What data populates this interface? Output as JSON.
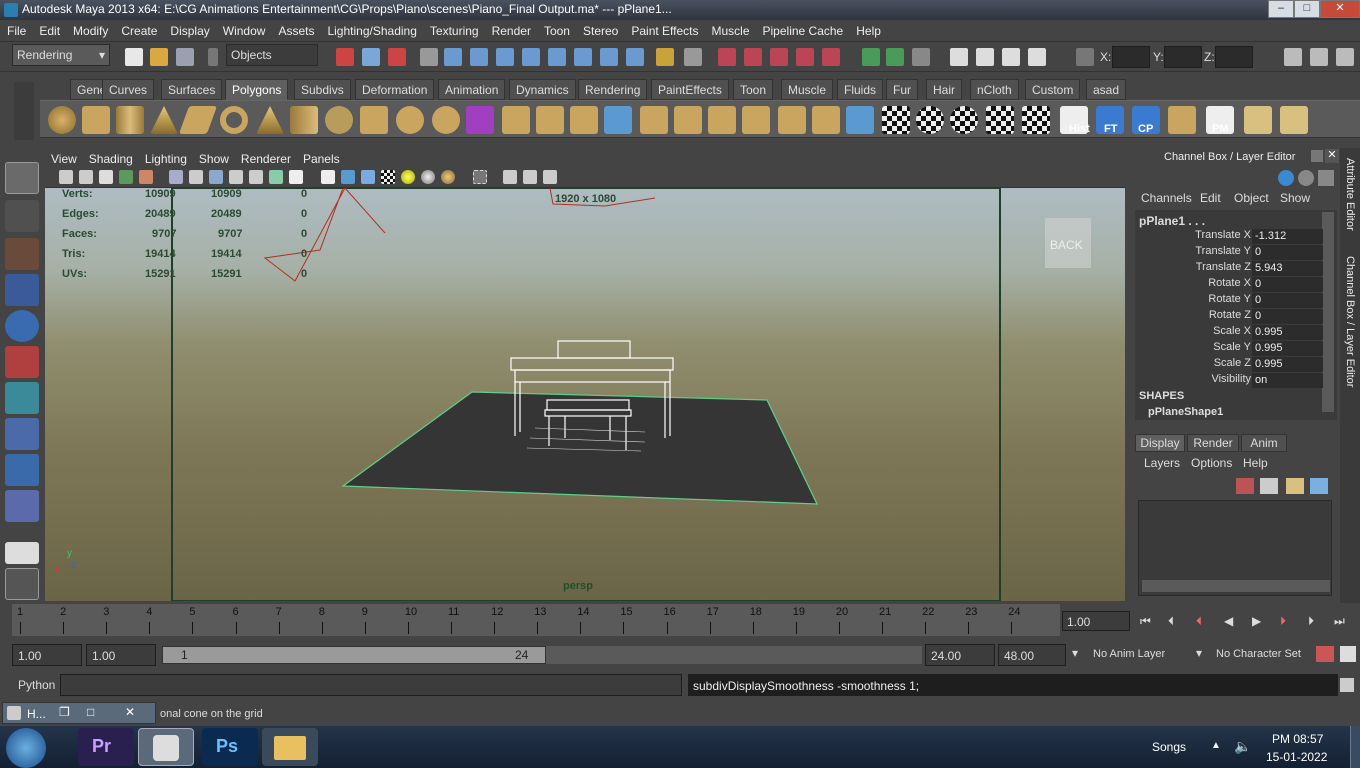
{
  "window": {
    "title": "Autodesk Maya 2013 x64: E:\\CG Animations Entertainment\\CG\\Props\\Piano\\scenes\\Piano_Final Output.ma*   ---   pPlane1...",
    "minimize": "–",
    "maximize": "□",
    "close": "✕"
  },
  "menubar": [
    "File",
    "Edit",
    "Modify",
    "Create",
    "Display",
    "Window",
    "Assets",
    "Lighting/Shading",
    "Texturing",
    "Render",
    "Toon",
    "Stereo",
    "Paint Effects",
    "Muscle",
    "Pipeline Cache",
    "Help"
  ],
  "statusline": {
    "menuset": "Rendering",
    "selection_mode": "Objects",
    "x_label": "X:",
    "y_label": "Y:",
    "z_label": "Z:"
  },
  "shelf": {
    "tabs": [
      "General",
      "Curves",
      "Surfaces",
      "Polygons",
      "Subdivs",
      "Deformation",
      "Animation",
      "Dynamics",
      "Rendering",
      "PaintEffects",
      "Toon",
      "Muscle",
      "Fluids",
      "Fur",
      "Hair",
      "nCloth",
      "Custom",
      "asad"
    ],
    "active_tab": "Polygons",
    "labels": {
      "hist": "Hist",
      "ft": "FT",
      "cp": "CP",
      "pm": "PM"
    }
  },
  "panel": {
    "menus": [
      "View",
      "Shading",
      "Lighting",
      "Show",
      "Renderer",
      "Panels"
    ],
    "resolution_gate": "1920 x 1080",
    "camera_name": "persp",
    "viewcube_face": "BACK",
    "axis_y": "y",
    "axis_x": "x",
    "axis_z": "z"
  },
  "hud_stats": [
    {
      "label": "Verts:",
      "a": "10909",
      "b": "10909",
      "c": "0"
    },
    {
      "label": "Edges:",
      "a": "20489",
      "b": "20489",
      "c": "0"
    },
    {
      "label": "Faces:",
      "a": "9707",
      "b": "9707",
      "c": "0"
    },
    {
      "label": "Tris:",
      "a": "19414",
      "b": "19414",
      "c": "0"
    },
    {
      "label": "UVs:",
      "a": "15291",
      "b": "15291",
      "c": "0"
    }
  ],
  "channelbox": {
    "header": "Channel Box / Layer Editor",
    "menus": [
      "Channels",
      "Edit",
      "Object",
      "Show"
    ],
    "object": "pPlane1 . . .",
    "attributes": [
      {
        "name": "Translate X",
        "value": "-1.312"
      },
      {
        "name": "Translate Y",
        "value": "0"
      },
      {
        "name": "Translate Z",
        "value": "5.943"
      },
      {
        "name": "Rotate X",
        "value": "0"
      },
      {
        "name": "Rotate Y",
        "value": "0"
      },
      {
        "name": "Rotate Z",
        "value": "0"
      },
      {
        "name": "Scale X",
        "value": "0.995"
      },
      {
        "name": "Scale Y",
        "value": "0.995"
      },
      {
        "name": "Scale Z",
        "value": "0.995"
      },
      {
        "name": "Visibility",
        "value": "on"
      }
    ],
    "shapes_label": "SHAPES",
    "shape_name": "pPlaneShape1"
  },
  "layereditor": {
    "tabs": [
      "Display",
      "Render",
      "Anim"
    ],
    "menus": [
      "Layers",
      "Options",
      "Help"
    ]
  },
  "side_tabs": {
    "attribute_editor": "Attribute Editor",
    "channel_box": "Channel Box / Layer Editor"
  },
  "timeline": {
    "frames": [
      "1",
      "2",
      "3",
      "4",
      "5",
      "6",
      "7",
      "8",
      "9",
      "10",
      "11",
      "12",
      "13",
      "14",
      "15",
      "16",
      "17",
      "18",
      "19",
      "20",
      "21",
      "22",
      "23",
      "24"
    ],
    "current_frame": "1.00"
  },
  "range": {
    "start": "1.00",
    "range_start": "1.00",
    "slider_start": "1",
    "slider_end": "24",
    "range_end": "24.00",
    "end": "48.00",
    "anim_layer": "No Anim Layer",
    "char_set": "No Character Set"
  },
  "cmdline": {
    "lang": "Python",
    "result": "subdivDisplaySmoothness -smoothness 1;"
  },
  "helpline": {
    "text": "onal cone on the grid",
    "mini_title": "H..."
  },
  "taskbar": {
    "tray_label": "Songs",
    "time": "PM 08:57",
    "date": "15-01-2022",
    "apps": [
      "Pr",
      "Ps"
    ]
  }
}
